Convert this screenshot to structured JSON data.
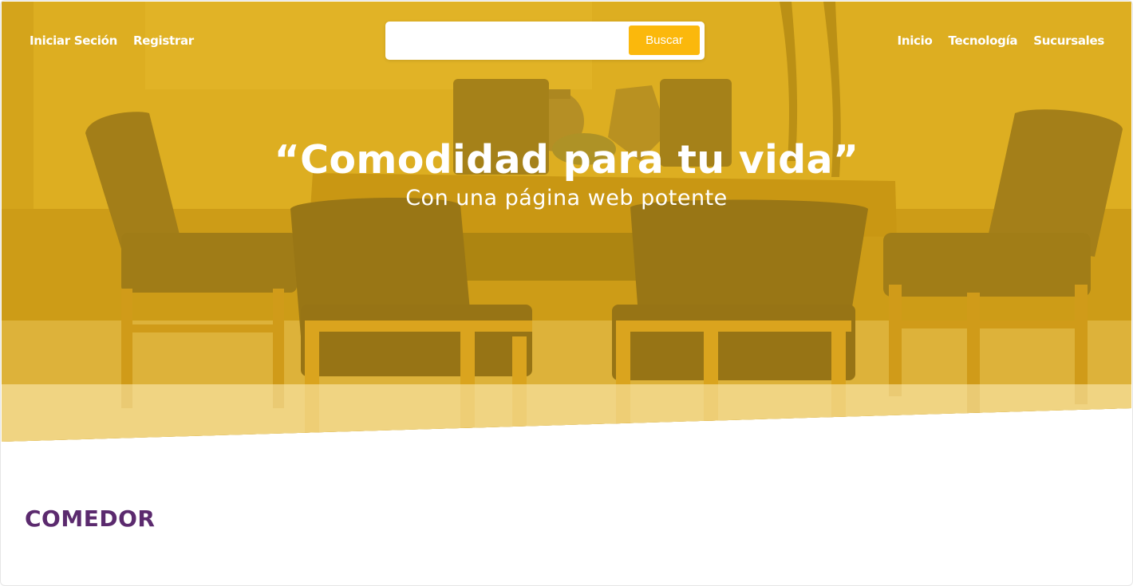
{
  "nav": {
    "left": [
      {
        "label": "Iniciar Seción"
      },
      {
        "label": "Registrar"
      }
    ],
    "right": [
      {
        "label": "Inicio"
      },
      {
        "label": "Tecnología"
      },
      {
        "label": "Sucursales"
      }
    ]
  },
  "search": {
    "value": "",
    "placeholder": "",
    "button_label": "Buscar"
  },
  "hero": {
    "title": "“Comodidad para tu vida”",
    "subtitle": "Con una página web potente"
  },
  "section": {
    "title": "COMEDOR"
  },
  "colors": {
    "accent": "#fbb80c",
    "hero_overlay": "#e8b81e",
    "section_title": "#5b2a6e"
  }
}
